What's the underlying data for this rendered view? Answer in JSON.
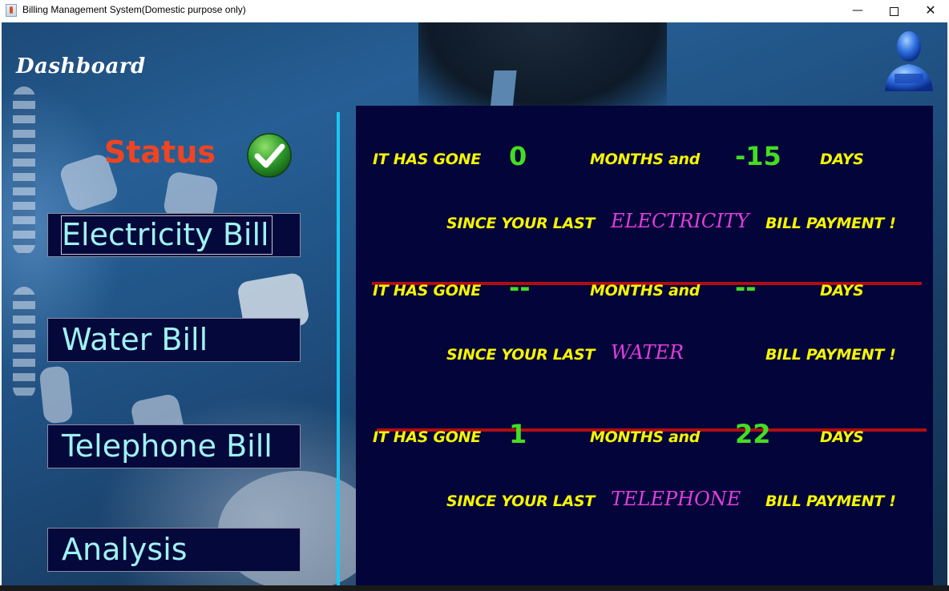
{
  "window": {
    "title": "Billing Management System(Domestic purpose only)",
    "controls": {
      "minimize": "—",
      "maximize": "☐",
      "close": "✕"
    },
    "icon": "java-app-icon"
  },
  "dashboard": {
    "title": "Dashboard",
    "avatar_icon": "user-icon"
  },
  "status": {
    "label": "Status",
    "icon": "check-icon"
  },
  "nav": {
    "electricity": "Electricity Bill",
    "water": "Water Bill",
    "telephone": "Telephone Bill",
    "analysis": "Analysis"
  },
  "panel": {
    "rows": [
      {
        "prefix": "IT HAS GONE",
        "months": "0",
        "months_label": "MONTHS and",
        "days": "-15",
        "days_label": "DAYS",
        "since": "SINCE YOUR LAST",
        "bill": "ELECTRICITY",
        "suffix": "BILL PAYMENT !"
      },
      {
        "prefix": "IT HAS GONE",
        "months": "--",
        "months_label": "MONTHS and",
        "days": "--",
        "days_label": "DAYS",
        "since": "SINCE YOUR LAST",
        "bill": "WATER",
        "suffix": "BILL PAYMENT !"
      },
      {
        "prefix": "IT HAS GONE",
        "months": "1",
        "months_label": "MONTHS and",
        "days": "22",
        "days_label": "DAYS",
        "since": "SINCE YOUR LAST",
        "bill": "TELEPHONE",
        "suffix": "BILL PAYMENT !"
      }
    ]
  },
  "colors": {
    "panel_bg": "#02043a",
    "label_yellow": "#f5f500",
    "number_green": "#44dd22",
    "bill_magenta": "#e33dd8",
    "status_red": "#ef4422",
    "divider_cyan": "#19c6f5",
    "divider_red": "#b00e12",
    "nav_text": "#9ff2f2"
  }
}
